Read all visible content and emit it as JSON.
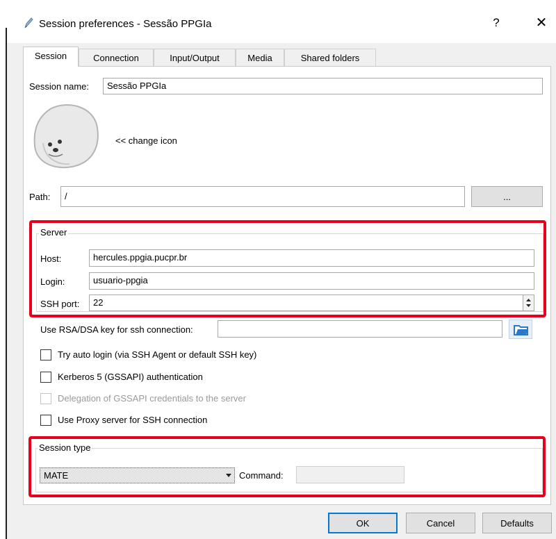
{
  "window": {
    "title": "Session preferences - Sessão PPGIa",
    "help_glyph": "?",
    "close_glyph": "✕"
  },
  "tabs": [
    {
      "label": "Session"
    },
    {
      "label": "Connection"
    },
    {
      "label": "Input/Output"
    },
    {
      "label": "Media"
    },
    {
      "label": "Shared folders"
    }
  ],
  "session": {
    "name_label": "Session name:",
    "name_value": "Sessão PPGIa",
    "change_icon_label": "<< change icon",
    "path_label": "Path:",
    "path_value": "/",
    "browse_label": "..."
  },
  "server": {
    "group_title": "Server",
    "host_label": "Host:",
    "host_value": "hercules.ppgia.pucpr.br",
    "login_label": "Login:",
    "login_value": "usuario-ppgia",
    "port_label": "SSH port:",
    "port_value": "22"
  },
  "ssh": {
    "rsa_label": "Use RSA/DSA key for ssh connection:",
    "rsa_value": "",
    "auto_login_label": "Try auto login (via SSH Agent or default SSH key)",
    "kerberos_label": "Kerberos 5 (GSSAPI) authentication",
    "delegation_label": "Delegation of GSSAPI credentials to the server",
    "proxy_label": "Use Proxy server for SSH connection"
  },
  "session_type": {
    "group_title": "Session type",
    "selected": "MATE",
    "command_label": "Command:",
    "command_value": ""
  },
  "footer": {
    "ok_label": "OK",
    "cancel_label": "Cancel",
    "defaults_label": "Defaults"
  },
  "colors": {
    "highlight": "#e8001c",
    "dialog_bg": "#f0f0f0",
    "ok_border": "#0078d7",
    "folder_icon": "#2b78c5"
  },
  "icons": {
    "title": "pencil-icon",
    "session": "seal-icon",
    "browse_key": "folder-open-icon"
  }
}
